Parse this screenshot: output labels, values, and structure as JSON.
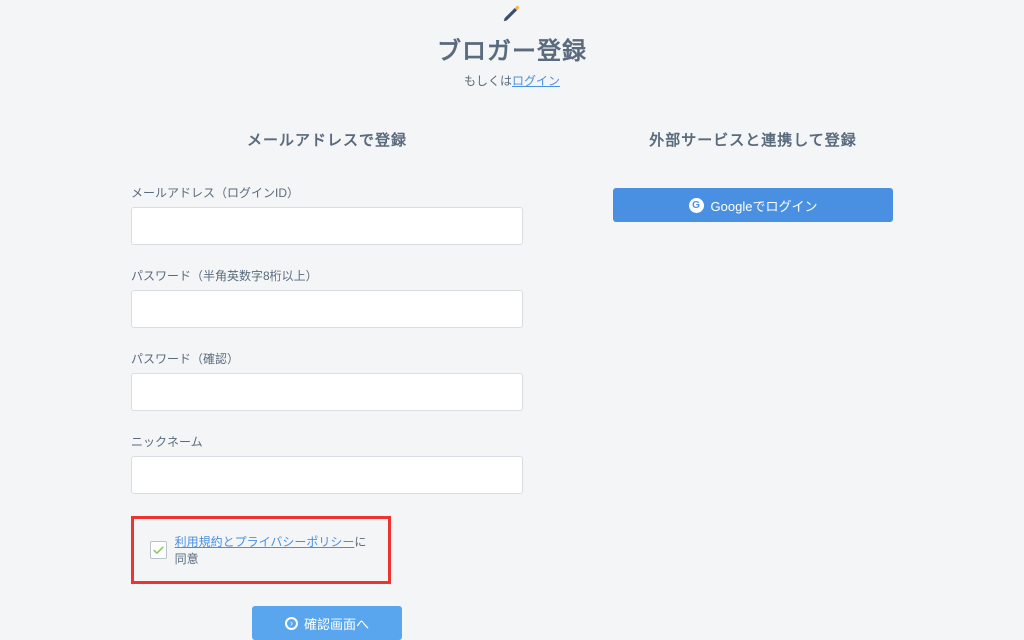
{
  "header": {
    "title": "ブロガー登録",
    "sub_prefix": "もしくは",
    "login_link": "ログイン"
  },
  "left": {
    "section_title": "メールアドレスで登録",
    "fields": {
      "email": {
        "label": "メールアドレス（ログインID）",
        "value": ""
      },
      "password": {
        "label": "パスワード（半角英数字8桁以上）",
        "value": ""
      },
      "password_confirm": {
        "label": "パスワード（確認）",
        "value": ""
      },
      "nickname": {
        "label": "ニックネーム",
        "value": ""
      }
    },
    "agree": {
      "link_text": "利用規約とプライバシーポリシー",
      "suffix": "に同意",
      "checked": true
    },
    "confirm_label": "確認画面へ"
  },
  "right": {
    "section_title": "外部サービスと連携して登録",
    "google_label": "Googleでログイン"
  }
}
